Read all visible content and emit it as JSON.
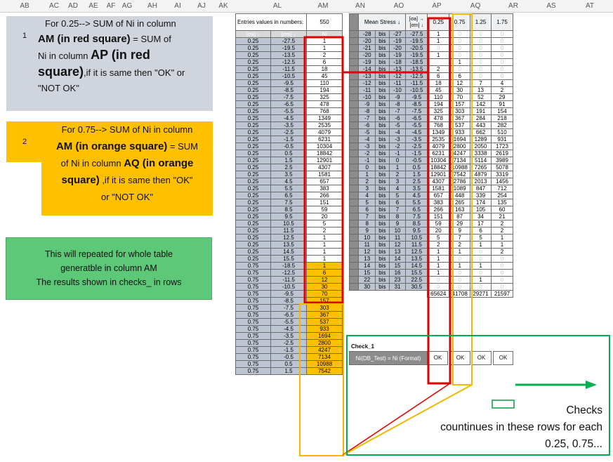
{
  "col_headers": [
    "AB",
    "AC",
    "AD",
    "AE",
    "AF",
    "AG",
    "AH",
    "AI",
    "AJ",
    "AK",
    "AL",
    "AM",
    "AN",
    "AO",
    "AP",
    "AQ",
    "AR",
    "AS",
    "AT"
  ],
  "note1": {
    "number": "1",
    "line1": "For 0.25--> SUM of Ni in column",
    "line2_bold": "AM (in red square)",
    "line2": " = SUM of",
    "line3": "Ni in column ",
    "line3_bold": "AP (in red",
    "line4_bold": "square)",
    "line4": ",if it is same then \"OK\" or",
    "line5": "\"NOT OK\""
  },
  "note2": {
    "number": "2",
    "line1": "For 0.75--> SUM of Ni in column",
    "line2_bold": "AM (in orange square)",
    "line2": " = SUM",
    "line3": "of Ni in column ",
    "line3_bold": "AQ (in orange",
    "line4_bold": "square)",
    "line4": " ,if it is same then \"OK\"",
    "line5": "or \"NOT OK\""
  },
  "note3": {
    "line1": "This will repeated for whole table",
    "line2": "generatble in column AM",
    "line3": "The results shown in checks_ in rows"
  },
  "table1": {
    "entries_label": "Entries values in numbers.",
    "entries_value": "550",
    "headers": [
      "[σa] ↓",
      "[σm] ↓",
      "Ni"
    ],
    "rows": [
      [
        "0.25",
        "-27.5",
        "1"
      ],
      [
        "0.25",
        "-19.5",
        "1"
      ],
      [
        "0.25",
        "-13.5",
        "2"
      ],
      [
        "0.25",
        "-12.5",
        "6"
      ],
      [
        "0.25",
        "-11.5",
        "18"
      ],
      [
        "0.25",
        "-10.5",
        "45"
      ],
      [
        "0.25",
        "-9.5",
        "110"
      ],
      [
        "0.25",
        "-8.5",
        "194"
      ],
      [
        "0.25",
        "-7.5",
        "325"
      ],
      [
        "0.25",
        "-6.5",
        "478"
      ],
      [
        "0.25",
        "-5.5",
        "768"
      ],
      [
        "0.25",
        "-4.5",
        "1349"
      ],
      [
        "0.25",
        "-3.5",
        "2535"
      ],
      [
        "0.25",
        "-2.5",
        "4079"
      ],
      [
        "0.25",
        "-1.5",
        "6231"
      ],
      [
        "0.25",
        "-0.5",
        "10304"
      ],
      [
        "0.25",
        "0.5",
        "18842"
      ],
      [
        "0.25",
        "1.5",
        "12901"
      ],
      [
        "0.25",
        "2.5",
        "4307"
      ],
      [
        "0.25",
        "3.5",
        "1581"
      ],
      [
        "0.25",
        "4.5",
        "657"
      ],
      [
        "0.25",
        "5.5",
        "383"
      ],
      [
        "0.25",
        "6.5",
        "266"
      ],
      [
        "0.25",
        "7.5",
        "151"
      ],
      [
        "0.25",
        "8.5",
        "59"
      ],
      [
        "0.25",
        "9.5",
        "20"
      ],
      [
        "0.25",
        "10.5",
        "5"
      ],
      [
        "0.25",
        "11.5",
        "2"
      ],
      [
        "0.25",
        "12.5",
        "1"
      ],
      [
        "0.25",
        "13.5",
        "1"
      ],
      [
        "0.25",
        "14.5",
        "1"
      ],
      [
        "0.25",
        "15.5",
        "1"
      ],
      [
        "0.75",
        "-18.5",
        "1"
      ],
      [
        "0.75",
        "-12.5",
        "6"
      ],
      [
        "0.75",
        "-11.5",
        "12"
      ],
      [
        "0.75",
        "-10.5",
        "30"
      ],
      [
        "0.75",
        "-9.5",
        "70"
      ],
      [
        "0.75",
        "-8.5",
        "157"
      ],
      [
        "0.75",
        "-7.5",
        "303"
      ],
      [
        "0.75",
        "-6.5",
        "367"
      ],
      [
        "0.75",
        "-5.5",
        "537"
      ],
      [
        "0.75",
        "-4.5",
        "933"
      ],
      [
        "0.75",
        "-3.5",
        "1694"
      ],
      [
        "0.75",
        "-2.5",
        "2800"
      ],
      [
        "0.75",
        "-1.5",
        "4247"
      ],
      [
        "0.75",
        "-0.5",
        "7134"
      ],
      [
        "0.75",
        "0.5",
        "10988"
      ],
      [
        "0.75",
        "1.5",
        "7542"
      ]
    ]
  },
  "table2": {
    "headers": {
      "mean_stress": "Mean Stress ↓",
      "sa_sm": "[σa] → [σm] ↓",
      "c1": "0.25",
      "c2": "0.75",
      "c3": "1.25",
      "c4": "1.75"
    },
    "rows": [
      [
        "-28",
        "bis",
        "-27",
        "-27.5",
        "1",
        "0",
        "0",
        "0"
      ],
      [
        "-20",
        "bis",
        "-19",
        "-19.5",
        "1",
        "0",
        "0",
        "0"
      ],
      [
        "-21",
        "bis",
        "-20",
        "-20.5",
        "0",
        "0",
        "0",
        "0"
      ],
      [
        "-20",
        "bis",
        "-19",
        "-19.5",
        "1",
        "0",
        "0",
        "0"
      ],
      [
        "-19",
        "bis",
        "-18",
        "-18.5",
        "",
        "1",
        "0",
        "0"
      ],
      [
        "-14",
        "bis",
        "-13",
        "-13.5",
        "2",
        "0",
        "0",
        "0"
      ],
      [
        "-13",
        "bis",
        "-12",
        "-12.5",
        "6",
        "6",
        "0",
        "0"
      ],
      [
        "-12",
        "bis",
        "-11",
        "-11.5",
        "18",
        "12",
        "7",
        "4"
      ],
      [
        "-11",
        "bis",
        "-10",
        "-10.5",
        "45",
        "30",
        "13",
        "2"
      ],
      [
        "-10",
        "bis",
        "-9",
        "-9.5",
        "110",
        "70",
        "52",
        "29"
      ],
      [
        "-9",
        "bis",
        "-8",
        "-8.5",
        "194",
        "157",
        "142",
        "91"
      ],
      [
        "-8",
        "bis",
        "-7",
        "-7.5",
        "325",
        "303",
        "191",
        "154"
      ],
      [
        "-7",
        "bis",
        "-6",
        "-6.5",
        "478",
        "367",
        "284",
        "218"
      ],
      [
        "-6",
        "bis",
        "-5",
        "-5.5",
        "768",
        "537",
        "443",
        "282"
      ],
      [
        "-5",
        "bis",
        "-4",
        "-4.5",
        "1349",
        "933",
        "662",
        "510"
      ],
      [
        "-4",
        "bis",
        "-3",
        "-3.5",
        "2535",
        "1694",
        "1289",
        "931"
      ],
      [
        "-3",
        "bis",
        "-2",
        "-2.5",
        "4079",
        "2800",
        "2050",
        "1723"
      ],
      [
        "-2",
        "bis",
        "-1",
        "-1.5",
        "6231",
        "4247",
        "3338",
        "2619"
      ],
      [
        "-1",
        "bis",
        "0",
        "-0.5",
        "10304",
        "7134",
        "5114",
        "3989"
      ],
      [
        "0",
        "bis",
        "1",
        "0.5",
        "18842",
        "10988",
        "7265",
        "5078"
      ],
      [
        "1",
        "bis",
        "2",
        "1.5",
        "12901",
        "7542",
        "4879",
        "3319"
      ],
      [
        "2",
        "bis",
        "3",
        "2.5",
        "4307",
        "2786",
        "2013",
        "1456"
      ],
      [
        "3",
        "bis",
        "4",
        "3.5",
        "1581",
        "1089",
        "847",
        "712"
      ],
      [
        "4",
        "bis",
        "5",
        "4.5",
        "657",
        "448",
        "339",
        "254"
      ],
      [
        "5",
        "bis",
        "6",
        "5.5",
        "383",
        "265",
        "174",
        "135"
      ],
      [
        "6",
        "bis",
        "7",
        "6.5",
        "266",
        "163",
        "105",
        "60"
      ],
      [
        "7",
        "bis",
        "8",
        "7.5",
        "151",
        "87",
        "34",
        "21"
      ],
      [
        "8",
        "bis",
        "9",
        "8.5",
        "59",
        "29",
        "17",
        "2"
      ],
      [
        "9",
        "bis",
        "10",
        "9.5",
        "20",
        "9",
        "6",
        "2"
      ],
      [
        "10",
        "bis",
        "11",
        "10.5",
        "5",
        "7",
        "5",
        "1"
      ],
      [
        "11",
        "bis",
        "12",
        "11.5",
        "2",
        "2",
        "1",
        "1"
      ],
      [
        "12",
        "bis",
        "13",
        "12.5",
        "1",
        "1",
        "0",
        "2"
      ],
      [
        "13",
        "bis",
        "14",
        "13.5",
        "1",
        "0",
        "0",
        "0"
      ],
      [
        "14",
        "bis",
        "15",
        "14.5",
        "1",
        "1",
        "1",
        "0"
      ],
      [
        "15",
        "bis",
        "16",
        "15.5",
        "1",
        "0",
        "0",
        "0"
      ],
      [
        "22",
        "bis",
        "23",
        "22.5",
        "0",
        "0",
        "1",
        "0"
      ],
      [
        "30",
        "bis",
        "31",
        "30.5",
        "0",
        "0",
        "0",
        "0"
      ]
    ],
    "totals": [
      "65624",
      "41708",
      "29271",
      "21597"
    ]
  },
  "check": {
    "title": "Check_1",
    "label": "Ni(DB_Test) = Ni (Format)",
    "results": [
      "OK",
      "OK",
      "OK",
      "OK"
    ]
  },
  "annotation": {
    "line1": "Checks",
    "line2": "countinues in these rows for each",
    "line3": "0.25, 0.75..."
  },
  "colors": {
    "red": "#e00000",
    "orange": "#ffc000",
    "green": "#00b050",
    "gray_note": "#d0d5dd",
    "green_note": "#5cc878"
  }
}
